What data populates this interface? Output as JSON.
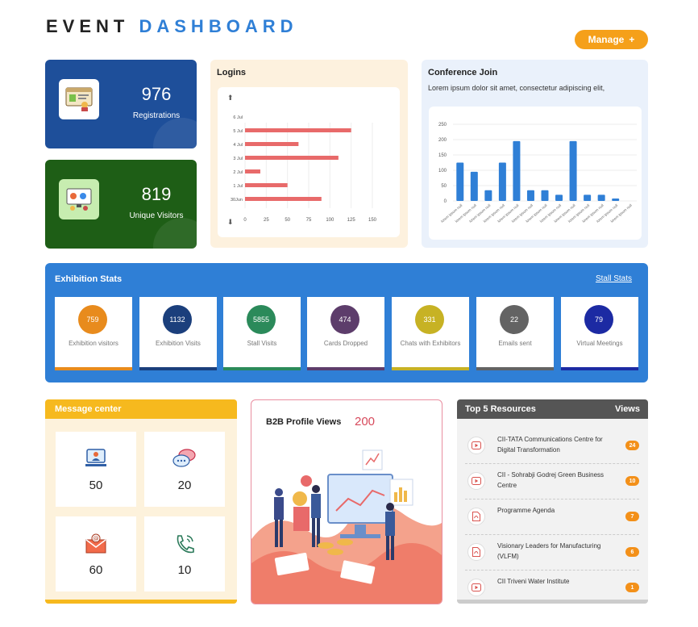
{
  "header": {
    "title_part1": "EVENT",
    "title_part2": "DASHBOARD",
    "manage_label": "Manage",
    "manage_icon": "+"
  },
  "stats": [
    {
      "value": "976",
      "label": "Registrations",
      "bg": "#1e4f9a",
      "icon": "registration-board-icon"
    },
    {
      "value": "819",
      "label": "Unique Visitors",
      "bg": "#1e5e16",
      "icon": "visitors-screen-icon"
    }
  ],
  "logins": {
    "title": "Logins",
    "up_arrow": "⬆",
    "down_arrow": "⬇"
  },
  "conference": {
    "title": "Conference Join",
    "subtitle": "Lorem ipsum dolor sit amet, consectetur adipiscing elit,"
  },
  "chart_data": [
    {
      "type": "bar",
      "orientation": "horizontal",
      "title": "Logins",
      "categories": [
        "6 Jul",
        "5 Jul",
        "4 Jul",
        "3 Jul",
        "2 Jul",
        "1 Jul",
        "30Jun"
      ],
      "values": [
        0,
        125,
        63,
        110,
        18,
        50,
        90
      ],
      "xticks": [
        "0",
        "25",
        "50",
        "75",
        "100",
        "125",
        "150"
      ],
      "xlim": [
        0,
        150
      ],
      "color": "#e86a6a",
      "grid": true
    },
    {
      "type": "bar",
      "title": "Conference Join",
      "categories": [
        "lorem ipsum null",
        "lorem ipsum null",
        "lorem ipsum null",
        "lorem ipsum null",
        "lorem ipsum null",
        "lorem ipsum null",
        "lorem ipsum null",
        "lorem ipsum null",
        "lorem ipsum null",
        "lorem ipsum null",
        "lorem ipsum null",
        "lorem ipsum null",
        "lorem ipsum null"
      ],
      "values": [
        125,
        95,
        35,
        125,
        195,
        35,
        35,
        20,
        195,
        20,
        20,
        8,
        0
      ],
      "yticks": [
        "0",
        "50",
        "100",
        "150",
        "200",
        "250"
      ],
      "ylim": [
        0,
        250
      ],
      "color": "#2f7fd6",
      "grid": true
    }
  ],
  "exhibition": {
    "title": "Exhibition Stats",
    "link": "Stall Stats",
    "items": [
      {
        "value": "759",
        "label": "Exhibition visitors",
        "color": "#e88b1d"
      },
      {
        "value": "1132",
        "label": "Exhibition Visits",
        "color": "#1b3f7c"
      },
      {
        "value": "5855",
        "label": "Stall Visits",
        "color": "#2b8a5a"
      },
      {
        "value": "474",
        "label": "Cards Dropped",
        "color": "#5d3d6b"
      },
      {
        "value": "331",
        "label": "Chats with Exhibitors",
        "color": "#c7b224"
      },
      {
        "value": "22",
        "label": "Emails sent",
        "color": "#636363"
      },
      {
        "value": "79",
        "label": "Virtual Meetings",
        "color": "#1c2aa3"
      }
    ]
  },
  "messages": {
    "title": "Message center",
    "items": [
      {
        "value": "50",
        "icon": "video-call-icon"
      },
      {
        "value": "20",
        "icon": "chat-bubbles-icon"
      },
      {
        "value": "60",
        "icon": "email-icon"
      },
      {
        "value": "10",
        "icon": "phone-call-icon"
      }
    ]
  },
  "b2b": {
    "title": "B2B Profile Views",
    "value": "200"
  },
  "resources": {
    "title": "Top 5 Resources",
    "views_label": "Views",
    "items": [
      {
        "title": "CII-TATA Communications Centre for Digital Transformation",
        "views": "24",
        "icon": "video-play-icon"
      },
      {
        "title": "CII - Sohrabji Godrej Green Business Centre",
        "views": "10",
        "icon": "video-play-icon"
      },
      {
        "title": "Programme Agenda",
        "views": "7",
        "icon": "pdf-file-icon"
      },
      {
        "title": "Visionary Leaders for Manufacturing (VLFM)",
        "views": "6",
        "icon": "pdf-file-icon"
      },
      {
        "title": "CII Triveni Water Institute",
        "views": "1",
        "icon": "video-play-icon"
      }
    ]
  }
}
